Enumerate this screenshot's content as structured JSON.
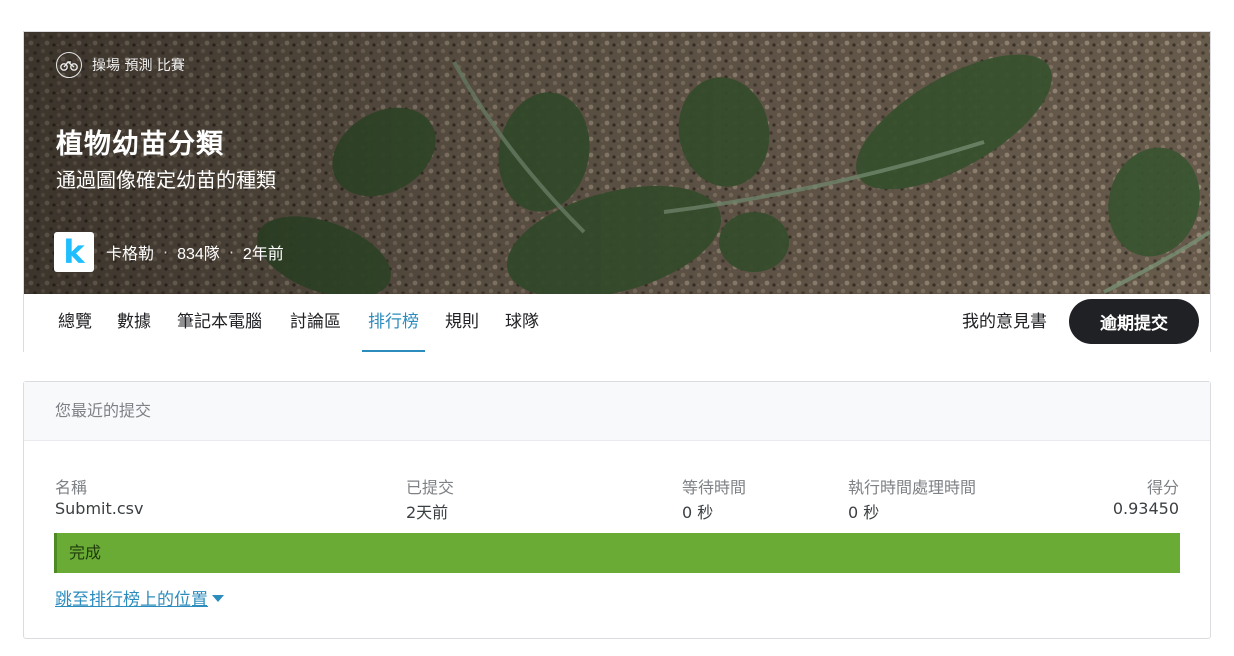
{
  "competition": {
    "tags": "操場 預測 比賽",
    "title": "植物幼苗分類",
    "subtitle": "通過圖像確定幼苗的種類",
    "host_logo_letter": "k",
    "host": "卡格勒",
    "teams": "834隊",
    "age": "2年前"
  },
  "tabs": [
    {
      "label": "總覽"
    },
    {
      "label": "數據"
    },
    {
      "label": "筆記本電腦"
    },
    {
      "label": "討論區"
    },
    {
      "label": "排行榜",
      "active": true
    },
    {
      "label": "規則"
    },
    {
      "label": "球隊"
    }
  ],
  "actions": {
    "my_notes": "我的意見書",
    "late_submit": "逾期提交"
  },
  "recent_submission": {
    "heading": "您最近的提交",
    "columns": {
      "name": "名稱",
      "submitted": "已提交",
      "wait_time": "等待時間",
      "exec_time": "執行時間處理時間",
      "score": "得分"
    },
    "row": {
      "name": "Submit.csv",
      "submitted": "2天前",
      "wait_time": "0 秒",
      "exec_time": "0 秒",
      "score": "0.93450"
    },
    "status": "完成",
    "jump_link": "跳至排行榜上的位置"
  },
  "colors": {
    "accent": "#2d8cbe",
    "status_green": "#6aab35",
    "button_dark": "#202124"
  },
  "icons": {
    "tag_icon": "bicycle-icon",
    "jump_caret": "caret-down-icon"
  }
}
